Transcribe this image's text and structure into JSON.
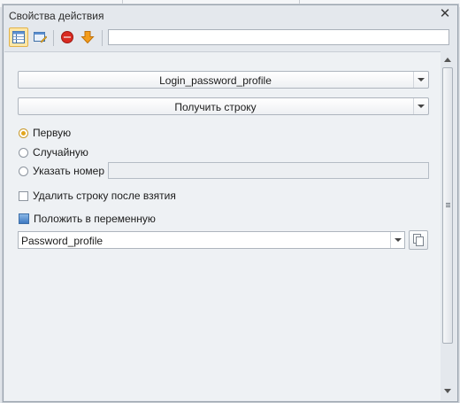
{
  "window": {
    "title": "Свойства действия"
  },
  "toolbar": {
    "buttons": [
      {
        "icon": "properties-grid-icon",
        "active": true
      },
      {
        "icon": "edit-action-icon",
        "active": false
      },
      {
        "icon": "stop-icon",
        "active": false
      },
      {
        "icon": "down-arrow-icon",
        "active": false
      }
    ],
    "search_value": ""
  },
  "form": {
    "profile_combo": "Login_password_profile",
    "operation_combo": "Получить строку",
    "radio_options": [
      {
        "label": "Первую",
        "selected": true
      },
      {
        "label": "Случайную",
        "selected": false
      },
      {
        "label": "Указать номер",
        "selected": false
      }
    ],
    "number_value": "",
    "delete_checkbox": {
      "label": "Удалить строку после взятия",
      "checked": false
    },
    "put_in_variable_label": "Положить в переменную",
    "variable_value": "Password_profile"
  },
  "colors": {
    "active_button": "#fde7a7",
    "stop_red": "#d92b22",
    "arrow_orange": "#f39c1a",
    "radio_selected": "#e3a61d"
  }
}
